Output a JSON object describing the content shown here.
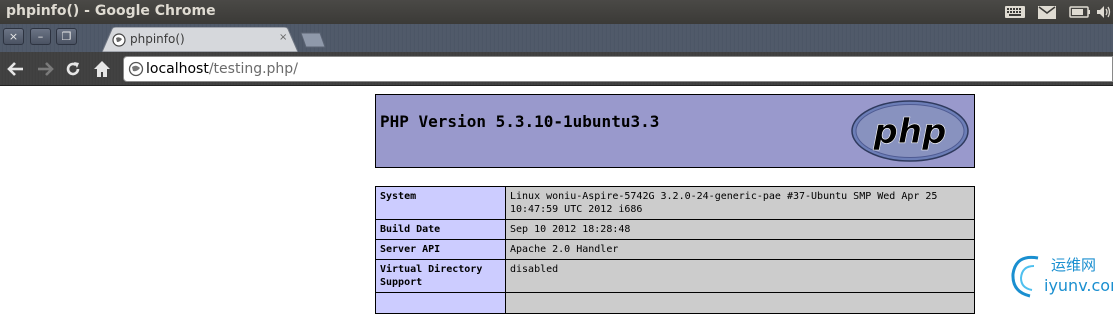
{
  "window": {
    "title": "phpinfo() - Google Chrome"
  },
  "tray": {
    "icons": [
      "keyboard-icon",
      "mail-icon",
      "battery-icon",
      "volume-icon"
    ]
  },
  "window_buttons": {
    "close": "×",
    "minimize": "–",
    "restore": "❐"
  },
  "tabs": [
    {
      "label": "phpinfo()"
    }
  ],
  "tab_close": "×",
  "toolbar": {
    "url_host": "localhost",
    "url_path": "/testing.php/"
  },
  "page": {
    "php_version": "PHP Version 5.3.10-1ubuntu3.3",
    "logo_text": "php",
    "rows": [
      {
        "label": "System",
        "value": "Linux woniu-Aspire-5742G 3.2.0-24-generic-pae #37-Ubuntu SMP Wed Apr 25 10:47:59 UTC 2012 i686"
      },
      {
        "label": "Build Date",
        "value": "Sep 10 2012 18:28:48"
      },
      {
        "label": "Server API",
        "value": "Apache 2.0 Handler"
      },
      {
        "label": "Virtual Directory Support",
        "value": "disabled"
      },
      {
        "label": "",
        "value": ""
      }
    ]
  },
  "watermark": {
    "cn": "运维网",
    "en": "iyunv.com"
  }
}
